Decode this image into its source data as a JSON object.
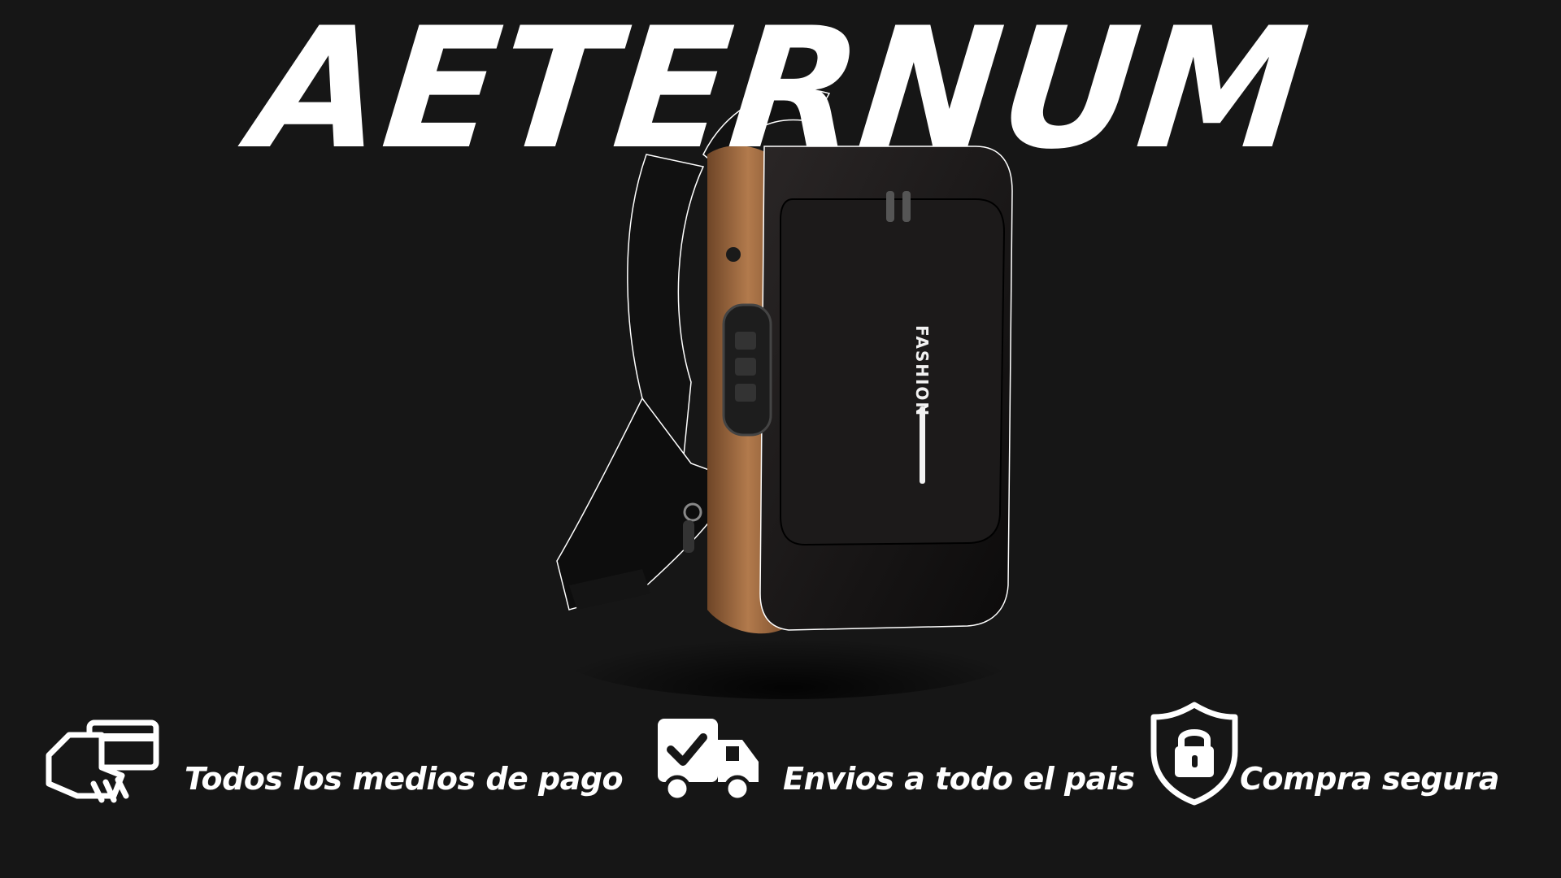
{
  "brand": {
    "name": "AETERNUM"
  },
  "product": {
    "print_text": "FASHION"
  },
  "features": [
    {
      "label": "Todos los medios de pago",
      "icon": "card-payment-icon"
    },
    {
      "label": "Envios a todo el pais",
      "icon": "delivery-truck-icon"
    },
    {
      "label": "Compra segura",
      "icon": "secure-shield-lock-icon"
    }
  ],
  "colors": {
    "background": "#161616",
    "text": "#ffffff",
    "accent": "#a0693f"
  }
}
